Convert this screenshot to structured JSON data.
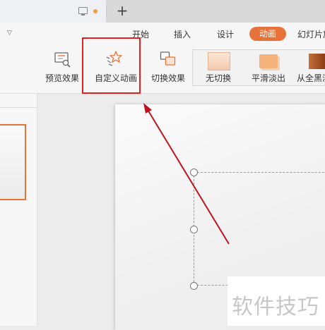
{
  "tabs": {
    "new_tab_symbol": "+"
  },
  "menu": {
    "items": [
      "开始",
      "插入",
      "设计",
      "动画",
      "幻灯片放"
    ],
    "active": "动画",
    "active_color": "#e8733a"
  },
  "ribbon": {
    "preview_label": "预览效果",
    "custom_animation_label": "自定义动画",
    "switch_effect_label": "切换效果",
    "transitions": [
      "无切换",
      "平滑淡出",
      "从全黑淡"
    ]
  },
  "annotation": {
    "highlight_color": "#e32020",
    "arrow_color": "#c0141c"
  },
  "watermark": {
    "text": "软件技巧"
  }
}
